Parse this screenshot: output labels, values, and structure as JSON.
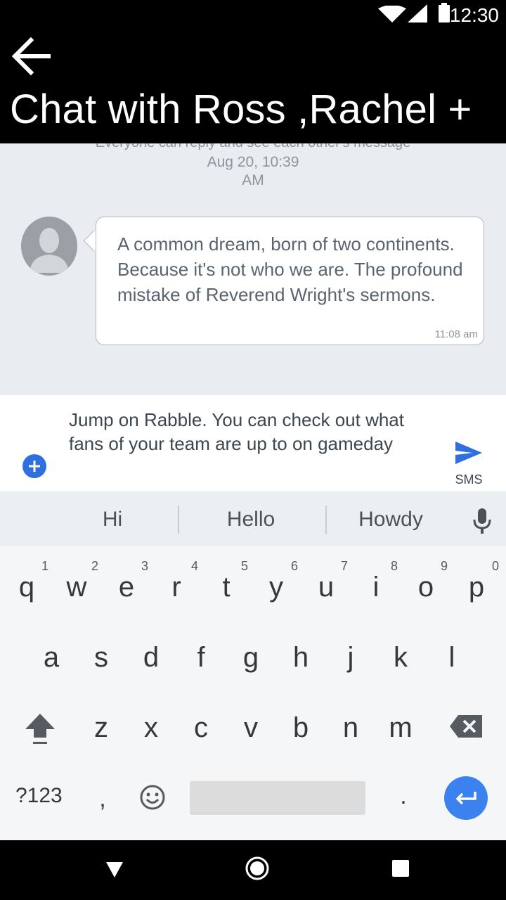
{
  "status_bar": {
    "time": "12:30",
    "icons": [
      "wifi-icon",
      "signal-icon",
      "battery-icon"
    ]
  },
  "app_bar": {
    "back_icon": "arrow-back-icon",
    "title": "Chat with Ross ,Rachel +"
  },
  "chat": {
    "system_note": "Everyone can reply and see each other's message",
    "date": "Aug 20, 10:39",
    "ampm": "AM",
    "message": {
      "text": "A common dream, born of two continents. Because it's not who we are. The profound mistake of Reverend Wright's sermons.",
      "time": "11:08 am"
    }
  },
  "composer": {
    "text": "Jump on Rabble. You can check out what fans of your team are up to on gameday",
    "send_label": "SMS"
  },
  "keyboard": {
    "suggestions": [
      "Hi",
      "Hello",
      "Howdy"
    ],
    "row1": [
      "q",
      "w",
      "e",
      "r",
      "t",
      "y",
      "u",
      "i",
      "o",
      "p"
    ],
    "row1_hints": [
      "1",
      "2",
      "3",
      "4",
      "5",
      "6",
      "7",
      "8",
      "9",
      "0"
    ],
    "row2": [
      "a",
      "s",
      "d",
      "f",
      "g",
      "h",
      "j",
      "k",
      "l"
    ],
    "row3": [
      "z",
      "x",
      "c",
      "v",
      "b",
      "n",
      "m"
    ],
    "symbols_label": "?123",
    "comma": ",",
    "period": "."
  },
  "colors": {
    "accent": "#2f6fe0",
    "chat_bg": "#e9ecf0",
    "enter_key": "#3b82f0"
  }
}
